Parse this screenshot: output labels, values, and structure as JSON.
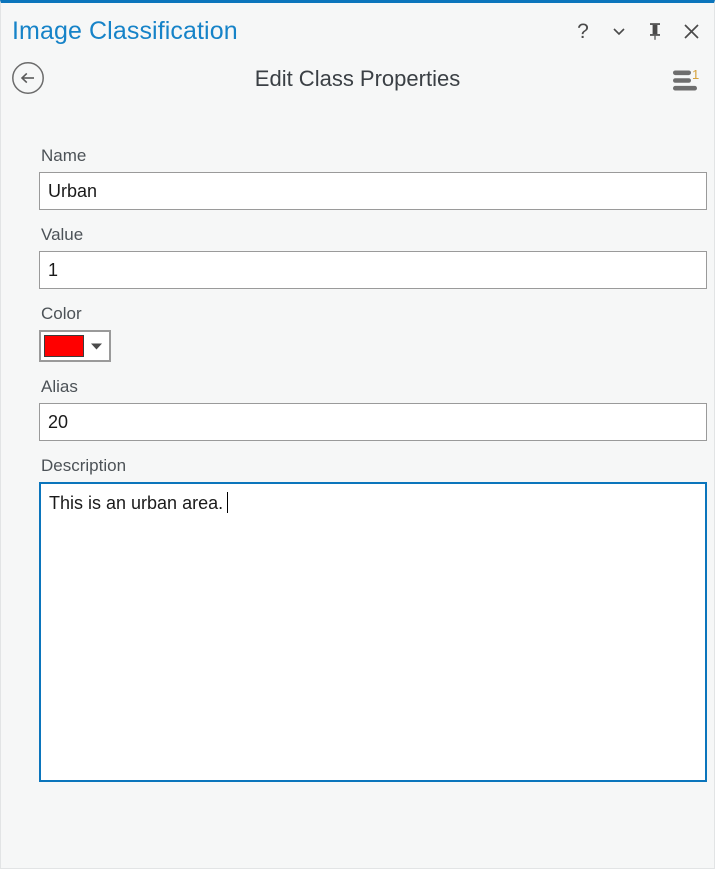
{
  "window": {
    "pane_title": "Image Classification",
    "accent_color": "#0b75bc",
    "title_color": "#1683c8",
    "background_color": "#f6f7f7"
  },
  "titlebar_actions": {
    "help_label": "?",
    "help_name": "help-icon",
    "menu_name": "chevron-down-icon",
    "pin_name": "pin-icon",
    "close_name": "close-icon"
  },
  "header": {
    "back_label": "Back",
    "view_title": "Edit Class Properties",
    "list_badge": "1"
  },
  "form": {
    "name": {
      "label": "Name",
      "value": "Urban",
      "placeholder": ""
    },
    "value": {
      "label": "Value",
      "value": "1",
      "placeholder": ""
    },
    "color": {
      "label": "Color",
      "swatch_color": "#ff0000"
    },
    "alias": {
      "label": "Alias",
      "value": "20",
      "placeholder": ""
    },
    "description": {
      "label": "Description",
      "value": "This is an urban area.",
      "placeholder": ""
    }
  }
}
